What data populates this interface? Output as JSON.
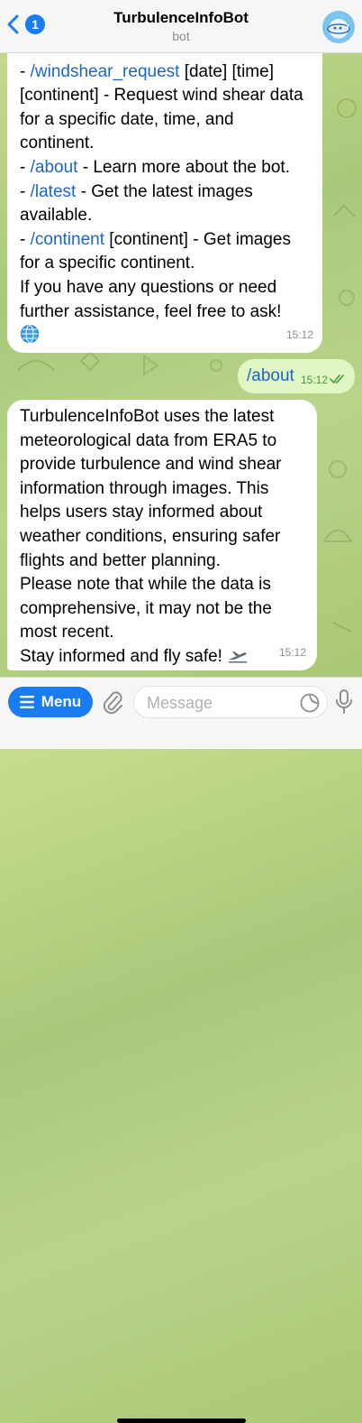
{
  "header": {
    "back_count": "1",
    "title": "TurbulenceInfoBot",
    "subtitle": "bot"
  },
  "messages": {
    "help": {
      "line1": "continent.",
      "ws_dash": "- ",
      "ws_cmd": "/windshear_request",
      "ws_args": " [date] [time] [continent] - Request wind shear data for a specific date, time, and continent.",
      "about_dash": "- ",
      "about_cmd": "/about",
      "about_text": " - Learn more about the bot.",
      "latest_dash": "- ",
      "latest_cmd": "/latest",
      "latest_text": " - Get the latest images available.",
      "cont_dash": "- ",
      "cont_cmd": "/continent",
      "cont_text": " [continent] - Get images for a specific continent.",
      "closing": "If you have any questions or need further assistance, feel free to ask!",
      "time": "15:12"
    },
    "sent": {
      "text": "/about",
      "time": "15:12"
    },
    "about": {
      "p1": "TurbulenceInfoBot uses the latest meteorological data from ERA5 to provide turbulence and wind shear information through images. This helps users stay informed about weather conditions, ensuring safer flights and better planning.",
      "p2": "Please note that while the data is comprehensive, it may not be the most recent.",
      "p3": "Stay informed and fly safe!",
      "time": "15:12"
    }
  },
  "input": {
    "menu_label": "Menu",
    "placeholder": "Message"
  },
  "colors": {
    "accent": "#1a7cf2",
    "command": "#1b66c6",
    "sent_bubble": "#e0f7c4"
  }
}
